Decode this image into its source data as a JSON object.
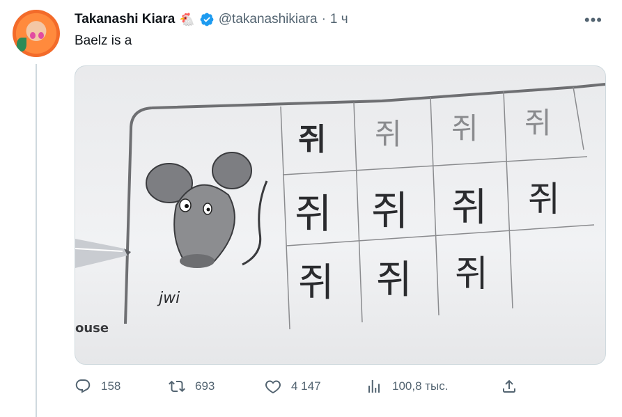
{
  "tweet": {
    "author_name": "Takanashi Kiara",
    "name_emoji": "🐔",
    "handle": "@takanashikiara",
    "separator": "·",
    "time": "1 ч",
    "text": "Baelz is a",
    "more_label": "•••"
  },
  "media": {
    "row1": [
      "쥐",
      "쥐",
      "쥐",
      "쥐"
    ],
    "row2": [
      "쥐",
      "쥐",
      "쥐",
      "쥐"
    ],
    "row3": [
      "쥐",
      "쥐",
      "쥐"
    ],
    "romanization": "jwi",
    "cut_label": "ouse"
  },
  "actions": {
    "reply_count": "158",
    "repost_count": "693",
    "like_count": "4 147",
    "views_count": "100,8 тыс."
  },
  "colors": {
    "text": "#0f1419",
    "secondary": "#536471",
    "verified": "#1d9bf0",
    "border": "#cfd9de"
  },
  "icons": [
    "reply-icon",
    "repost-icon",
    "like-icon",
    "views-icon",
    "share-icon",
    "verified-icon",
    "more-icon"
  ]
}
